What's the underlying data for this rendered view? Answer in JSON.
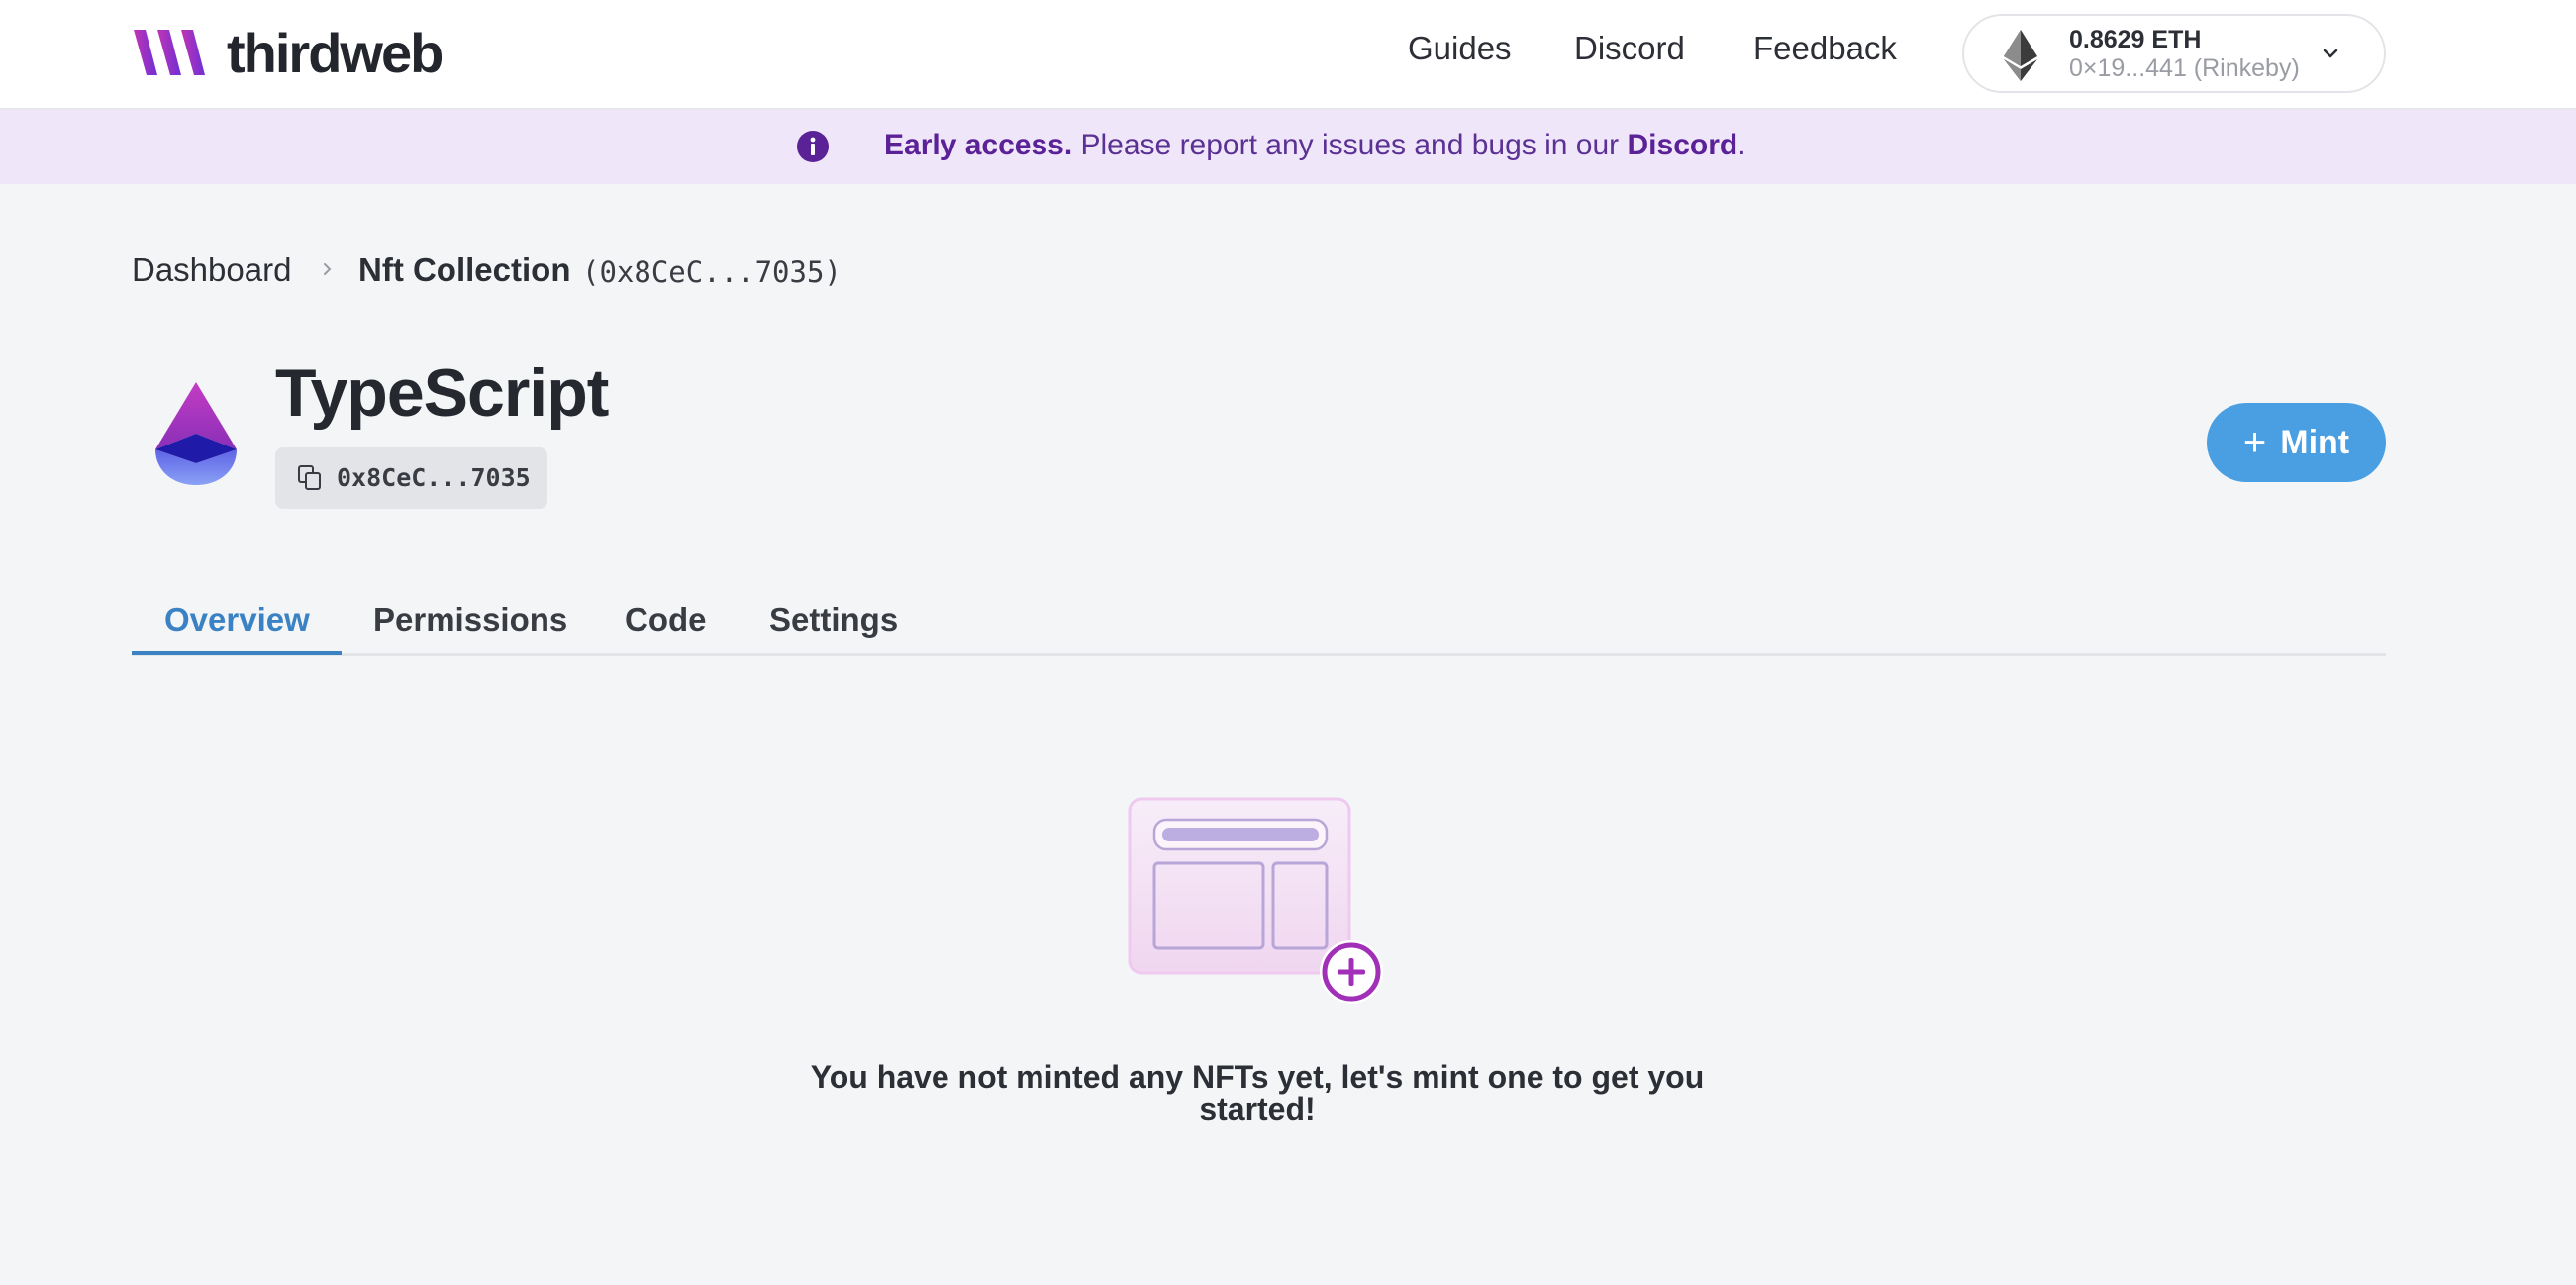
{
  "header": {
    "brand": "thirdweb",
    "nav": [
      {
        "label": "Guides"
      },
      {
        "label": "Discord"
      },
      {
        "label": "Feedback"
      }
    ],
    "wallet": {
      "balance": "0.8629 ETH",
      "address": "0×19...441 (Rinkeby)",
      "icon": "ethereum-icon"
    }
  },
  "banner": {
    "strong": "Early access.",
    "text": " Please report any issues and bugs in our ",
    "link": "Discord",
    "end": "."
  },
  "breadcrumb": {
    "root": "Dashboard",
    "current": "Nft Collection",
    "current_address": "(0x8CeC...7035)"
  },
  "contract": {
    "title": "TypeScript",
    "address": "0x8CeC...7035"
  },
  "actions": {
    "mint_icon": "+",
    "mint_label": "Mint"
  },
  "tabs": [
    {
      "label": "Overview",
      "active": true
    },
    {
      "label": "Permissions",
      "active": false
    },
    {
      "label": "Code",
      "active": false
    },
    {
      "label": "Settings",
      "active": false
    }
  ],
  "empty_state": {
    "message": "You have not minted any NFTs yet, let's mint one to get you started!"
  },
  "colors": {
    "accent": "#4a9fe2",
    "tab_active": "#3b82c4",
    "banner_bg": "#efe6fa",
    "banner_text": "#5b2196",
    "brand_gradient_start": "#c135b3",
    "brand_gradient_end": "#6e2fd6"
  }
}
